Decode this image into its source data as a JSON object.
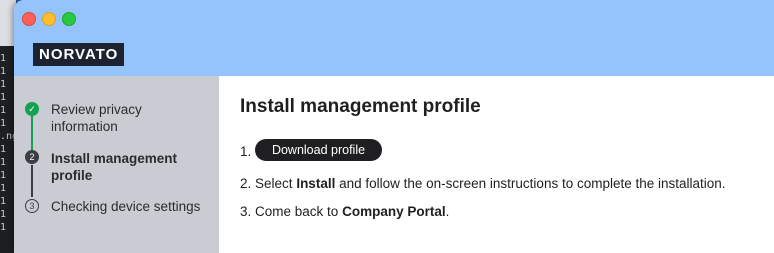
{
  "background": {
    "terminal_lines": [
      "1",
      "1",
      "1",
      "1",
      "1",
      "1",
      ".ng",
      "1",
      "1",
      "1",
      "1",
      "1",
      "1",
      "1"
    ]
  },
  "window": {
    "logo_text": "NORVATO"
  },
  "steps": [
    {
      "label": "Review privacy information",
      "status": "done",
      "marker": "✓"
    },
    {
      "label": "Install management profile",
      "status": "current",
      "marker": "2"
    },
    {
      "label": "Checking device settings",
      "status": "pending",
      "marker": "3"
    }
  ],
  "content": {
    "title": "Install management profile",
    "item1_number": "1.",
    "download_button": "Download profile",
    "item2_number": "2.",
    "item2_text_a": "Select ",
    "item2_bold": "Install",
    "item2_text_b": " and follow the on-screen instructions to complete the installation.",
    "item3_number": "3.",
    "item3_text_a": "Come back to ",
    "item3_bold": "Company Portal",
    "item3_text_b": "."
  },
  "colors": {
    "titlebar": "#95c3fb",
    "sidebar": "#c9cdd3",
    "done_green": "#14a051",
    "button_dark": "#1f1f21"
  }
}
